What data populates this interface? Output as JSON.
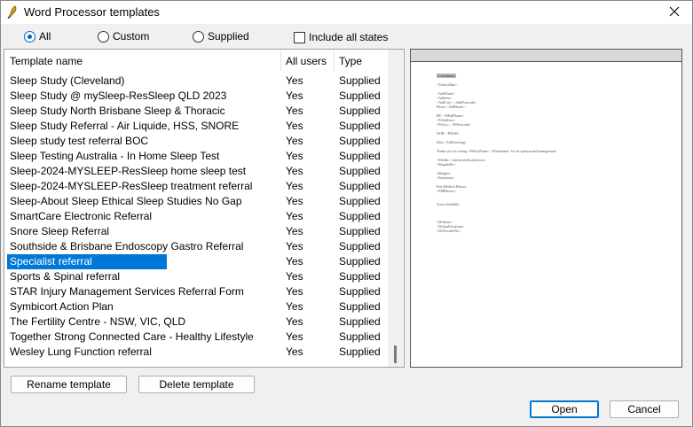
{
  "window": {
    "title": "Word Processor templates"
  },
  "filters": {
    "all": {
      "label": "All",
      "checked": true
    },
    "custom": {
      "label": "Custom",
      "checked": false
    },
    "supplied": {
      "label": "Supplied",
      "checked": false
    },
    "include_all_states": {
      "label": "Include all states",
      "checked": false
    }
  },
  "columns": {
    "name": "Template name",
    "all_users": "All users",
    "type": "Type"
  },
  "rows": [
    {
      "name": "Sleep Study (Cleveland)",
      "all_users": "Yes",
      "type": "Supplied"
    },
    {
      "name": "Sleep Study @ mySleep-ResSleep QLD 2023",
      "all_users": "Yes",
      "type": "Supplied"
    },
    {
      "name": "Sleep Study North Brisbane Sleep & Thoracic",
      "all_users": "Yes",
      "type": "Supplied"
    },
    {
      "name": "Sleep Study Referral - Air Liquide, HSS, SNORE",
      "all_users": "Yes",
      "type": "Supplied"
    },
    {
      "name": "Sleep study test referral BOC",
      "all_users": "Yes",
      "type": "Supplied"
    },
    {
      "name": "Sleep Testing Australia - In Home Sleep Test",
      "all_users": "Yes",
      "type": "Supplied"
    },
    {
      "name": "Sleep-2024-MYSLEEP-ResSleep home sleep test",
      "all_users": "Yes",
      "type": "Supplied"
    },
    {
      "name": "Sleep-2024-MYSLEEP-ResSleep treatment referral",
      "all_users": "Yes",
      "type": "Supplied"
    },
    {
      "name": "Sleep-About Sleep Ethical Sleep Studies No Gap",
      "all_users": "Yes",
      "type": "Supplied"
    },
    {
      "name": "SmartCare Electronic Referral",
      "all_users": "Yes",
      "type": "Supplied"
    },
    {
      "name": "Snore Sleep Referral",
      "all_users": "Yes",
      "type": "Supplied"
    },
    {
      "name": "Southside & Brisbane Endoscopy Gastro Referral",
      "all_users": "Yes",
      "type": "Supplied"
    },
    {
      "name": "Specialist referral",
      "all_users": "Yes",
      "type": "Supplied",
      "selected": true
    },
    {
      "name": "Sports & Spinal referral",
      "all_users": "Yes",
      "type": "Supplied"
    },
    {
      "name": "STAR Injury Management Services Referral Form",
      "all_users": "Yes",
      "type": "Supplied"
    },
    {
      "name": "Symbicort Action Plan",
      "all_users": "Yes",
      "type": "Supplied"
    },
    {
      "name": "The Fertility Centre - NSW, VIC, QLD",
      "all_users": "Yes",
      "type": "Supplied"
    },
    {
      "name": "Together Strong Connected Care - Healthy Lifestyle",
      "all_users": "Yes",
      "type": "Supplied"
    },
    {
      "name": "Wesley Lung Function referral",
      "all_users": "Yes",
      "type": "Supplied"
    }
  ],
  "preview_lines": [
    {
      "text": "<Letterhead>",
      "highlight": true
    },
    {
      "text": ""
    },
    {
      "text": "<TodaysDate>"
    },
    {
      "text": ""
    },
    {
      "text": "<AddName>"
    },
    {
      "text": "<Address>"
    },
    {
      "text": "<AddCity>  <AddPostcode>"
    },
    {
      "text": "Phone    <AddPhone>"
    },
    {
      "text": ""
    },
    {
      "text": "RE:      <PtFullName>"
    },
    {
      "text": "         <PtAddress>"
    },
    {
      "text": "         <PtCity>,  <PtPostcode>"
    },
    {
      "text": ""
    },
    {
      "text": "DOB:     <PtDoB>"
    },
    {
      "text": ""
    },
    {
      "text": "Dear <AddGreeting>"
    },
    {
      "text": ""
    },
    {
      "text": "Thank you for seeing <PtFirstName> <PtSurname> for an opinion and management."
    },
    {
      "text": ""
    },
    {
      "text": "<Medhx> current medications are:"
    },
    {
      "text": "<RegularRx>"
    },
    {
      "text": ""
    },
    {
      "text": "Allergies:"
    },
    {
      "text": "<Reactions>"
    },
    {
      "text": ""
    },
    {
      "text": "Past Medical History"
    },
    {
      "text": "<PMHistory>"
    },
    {
      "text": ""
    },
    {
      "text": ""
    },
    {
      "text": "Yours faithfully,"
    },
    {
      "text": ""
    },
    {
      "text": ""
    },
    {
      "text": ""
    },
    {
      "text": "<DrName>"
    },
    {
      "text": "<DrQualifications>"
    },
    {
      "text": "<DrProviderNo>"
    }
  ],
  "buttons": {
    "rename": "Rename template",
    "delete": "Delete template",
    "open": "Open",
    "cancel": "Cancel"
  }
}
